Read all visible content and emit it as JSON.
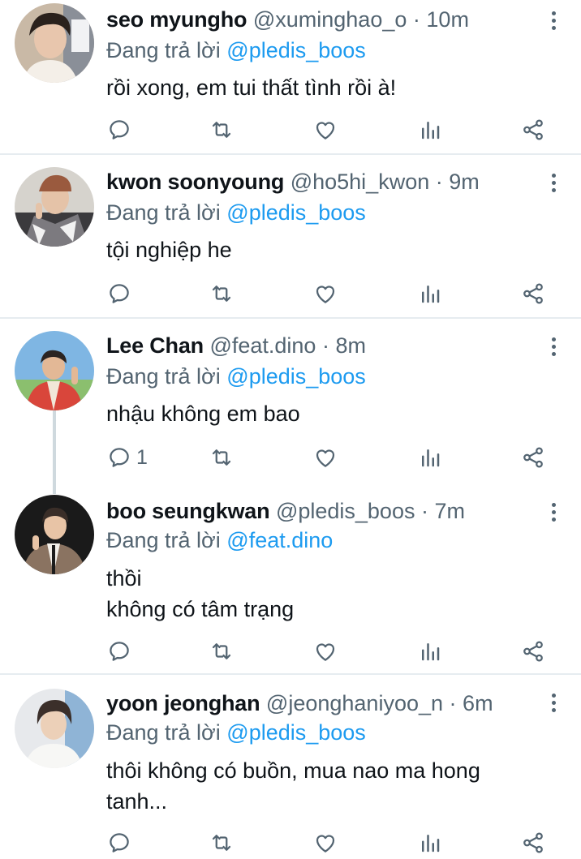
{
  "tweets": [
    {
      "name": "seo myungho",
      "handle": "@xuminghao_o",
      "separator": "·",
      "time": "10m",
      "reply_prefix": "Đang trả lời",
      "reply_to": "@pledis_boos",
      "text_lines": [
        "rồi xong, em tui thất tình rồi à!"
      ],
      "reply_count": ""
    },
    {
      "name": "kwon soonyoung",
      "handle": "@ho5hi_kwon",
      "separator": "·",
      "time": "9m",
      "reply_prefix": "Đang trả lời",
      "reply_to": "@pledis_boos",
      "text_lines": [
        "tội nghiệp he"
      ],
      "reply_count": ""
    },
    {
      "name": "Lee Chan",
      "handle": "@feat.dino",
      "separator": "·",
      "time": "8m",
      "reply_prefix": "Đang trả lời",
      "reply_to": "@pledis_boos",
      "text_lines": [
        "nhậu không em bao"
      ],
      "reply_count": "1"
    },
    {
      "name": "boo seungkwan",
      "handle": "@pledis_boos",
      "separator": "·",
      "time": "7m",
      "reply_prefix": "Đang trả lời",
      "reply_to": "@feat.dino",
      "text_lines": [
        "thồi",
        "không có tâm trạng"
      ],
      "reply_count": ""
    },
    {
      "name": "yoon jeonghan",
      "handle": "@jeonghaniyoo_n",
      "separator": "·",
      "time": "6m",
      "reply_prefix": "Đang trả lời",
      "reply_to": "@pledis_boos",
      "text_lines": [
        "thôi không có buồn, mua nao ma hong",
        "tanh..."
      ],
      "reply_count": ""
    }
  ],
  "icons": {
    "reply": "reply-icon",
    "retweet": "retweet-icon",
    "like": "heart-icon",
    "analytics": "analytics-icon",
    "share": "share-icon",
    "more": "more-vertical-icon"
  },
  "colors": {
    "text": "#0f1419",
    "muted": "#536471",
    "link": "#1d9bf0",
    "divider": "#e6ecf0"
  }
}
